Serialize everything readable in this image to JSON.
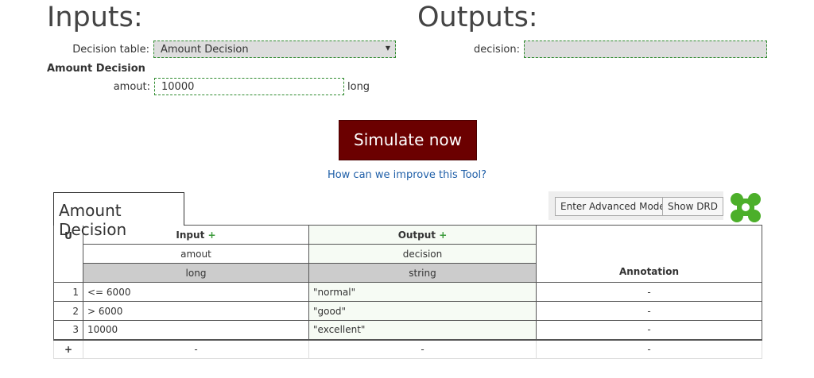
{
  "inputs_heading": "Inputs:",
  "outputs_heading": "Outputs:",
  "inputs": {
    "decision_table_label": "Decision table:",
    "decision_table_value": "Amount Decision",
    "section_title": "Amount Decision",
    "amout_label": "amout:",
    "amout_value": "10000",
    "amout_type": "long"
  },
  "outputs": {
    "decision_label": "decision:",
    "decision_value": ""
  },
  "simulate_label": "Simulate now",
  "improve_link": "How can we improve this Tool?",
  "table": {
    "name": "Amount Decision",
    "advanced_mode_label": "Enter Advanced Mode",
    "show_drd_label": "Show DRD",
    "hit_policy": "U",
    "input_header": "Input",
    "output_header": "Output",
    "annotation_header": "Annotation",
    "plus": "+",
    "input_name": "amout",
    "input_type": "long",
    "output_name": "decision",
    "output_type": "string",
    "rows": [
      {
        "num": "1",
        "input": "<= 6000",
        "output": "\"normal\"",
        "annotation": "-"
      },
      {
        "num": "2",
        "input": "> 6000",
        "output": "\"good\"",
        "annotation": "-"
      },
      {
        "num": "3",
        "input": "10000",
        "output": "\"excellent\"",
        "annotation": "-"
      }
    ],
    "footer": {
      "add": "+",
      "input": "-",
      "output": "-",
      "annotation": "-"
    }
  },
  "colors": {
    "accent": "#6b0000",
    "link": "#1f5fa8",
    "green": "#3a9a3a"
  }
}
